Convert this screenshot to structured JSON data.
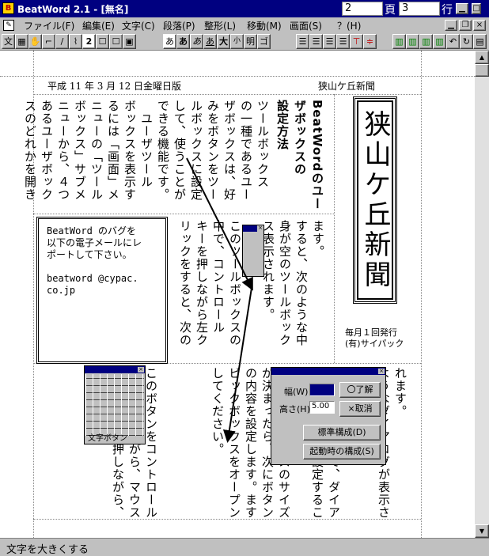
{
  "window": {
    "title": "BeatWord 2.1 - [無名]",
    "page_value": "2",
    "page_label": "頁",
    "line_value": "3",
    "line_label": "行"
  },
  "menu": {
    "items": [
      "ファイル(F)",
      "編集(E)",
      "文字(C)",
      "段落(P)",
      "整形(L)",
      "移動(M)",
      "画面(S)",
      "？(H)"
    ]
  },
  "toolbar": {
    "left_tools": [
      "文",
      "▦",
      "✋",
      "⌐",
      "/",
      "⌇",
      "2",
      "☐",
      "☐",
      "▣"
    ],
    "char_tools": [
      "あ",
      "あ",
      "あ",
      "あ",
      "大",
      "小",
      "明",
      "ゴ"
    ]
  },
  "header": {
    "date": "平成 11 年 3 月 12 日金曜日版",
    "paper_name": "狭山ケ丘新聞"
  },
  "masthead": {
    "title": "狭山ケ丘新聞",
    "issue": "毎月１回発行",
    "publisher": "(有)サイパック"
  },
  "article": {
    "heading": "BeatWordのユー\nザボックスの\n設定方法",
    "top_block": "ツールボックス\nの一種であるユー\nザボックスは、好\nみをボタンをツー\nルボックスに設定\nして、使うことが\nできる機能です。\n　ユーザツール\nボックスを表示す\nるには「画面」メ\nニューの「ツール\nボックス」サブメ\nニューから、４つ\nあるユーザボック\nスのどれかを開き",
    "mid_block": "ます。\nすると、次のような中\n身が空のツールボック\nス表示されます。\n\nこのツールボックスの\n中で、コントロール\nキーを押しながら左ク\nリックをすると、次の",
    "bottom_block": "れます。\nようなダイアログが表示さ\n\n\nこのダイアログで、ダイア\nログのサイズを設定するこ\nとができます。\n　ツールボックスのサイズ\nが決まったら、次にボタン\nの内容を設定します。ます\nビックボックスをオープン\nしてください。\n\n\n\nこのボタンをコントロール\nキーを押しながら、マウス\nの左ボタンを押しながら、"
  },
  "notice": {
    "text": "BeatWord のバグを\n以下の電子メールにレ\nポートして下さい。\n\nbeatword @cypac.\nco.jp"
  },
  "dialog": {
    "width_label": "幅(W)",
    "width_value": "",
    "height_label": "高さ(H)",
    "height_value": "5.00",
    "ok_label": "〇了解",
    "cancel_label": "×取消",
    "standard_label": "標準構成(D)",
    "startup_label": "起動時の構成(S)"
  },
  "button_palette": {
    "title": "文字ボタン"
  },
  "status": {
    "text": "文字を大きくする"
  }
}
